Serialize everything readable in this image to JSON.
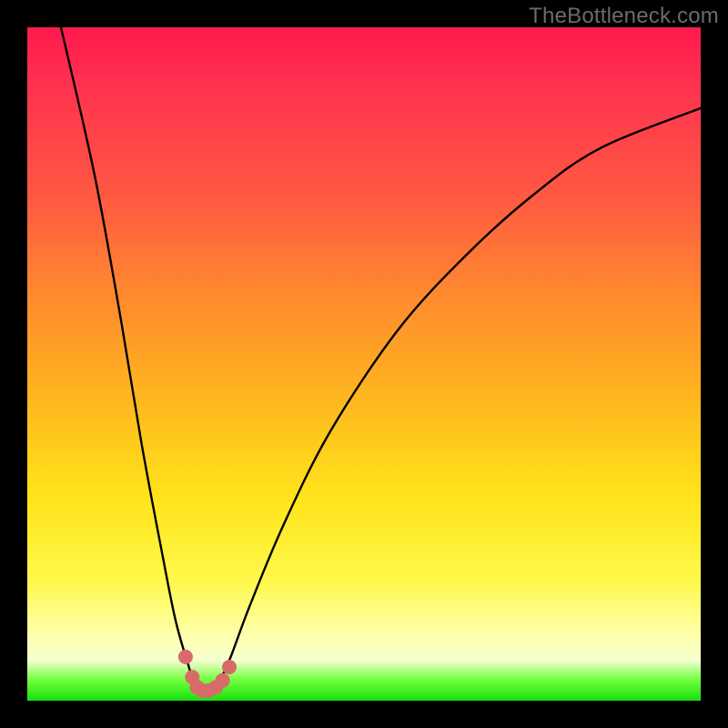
{
  "watermark": "TheBottleneck.com",
  "chart_data": {
    "type": "line",
    "title": "",
    "xlabel": "",
    "ylabel": "",
    "xlim": [
      0,
      100
    ],
    "ylim": [
      0,
      100
    ],
    "series": [
      {
        "name": "bottleneck-curve",
        "x": [
          5,
          10,
          14,
          17,
          20,
          22,
          24,
          25,
          26.5,
          28,
          30,
          33,
          38,
          45,
          55,
          65,
          75,
          85,
          100
        ],
        "values": [
          100,
          78,
          56,
          38,
          22,
          12,
          5,
          2,
          1,
          2,
          6,
          14,
          26,
          40,
          55,
          66,
          75,
          82,
          88
        ]
      }
    ],
    "markers": {
      "name": "minimum-highlight",
      "x": [
        23.5,
        24.5,
        25.2,
        26,
        27,
        28,
        29,
        30
      ],
      "values": [
        6.5,
        3.5,
        2,
        1.5,
        1.5,
        2,
        3,
        5
      ],
      "color": "#d96a6a",
      "size": 16
    },
    "background_gradient": {
      "stops": [
        {
          "pos": 0.0,
          "color": "#ff1a4d"
        },
        {
          "pos": 0.4,
          "color": "#ff8a2e"
        },
        {
          "pos": 0.7,
          "color": "#ffe41a"
        },
        {
          "pos": 0.92,
          "color": "#ffffb0"
        },
        {
          "pos": 1.0,
          "color": "#18e010"
        }
      ]
    }
  }
}
